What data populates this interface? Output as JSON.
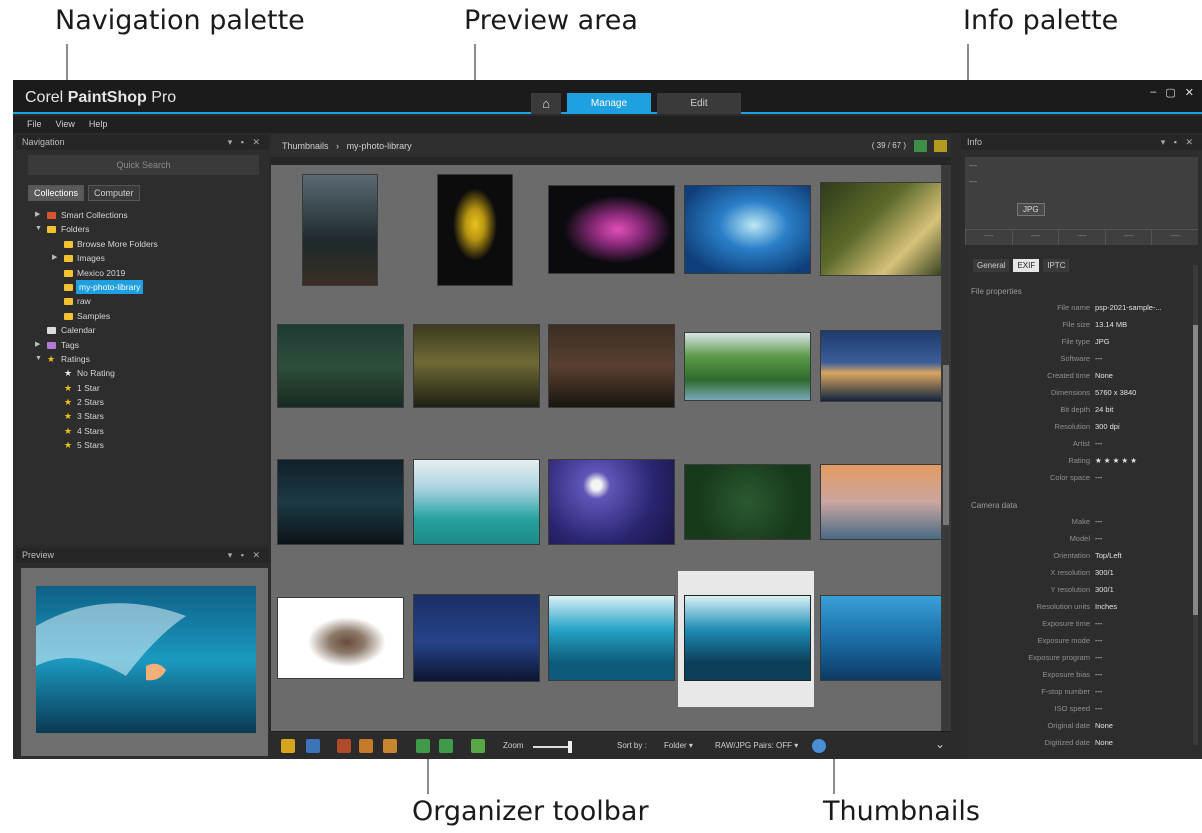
{
  "callouts": {
    "navigation": "Navigation palette",
    "preview_area": "Preview area",
    "info": "Info palette",
    "organizer": "Organizer toolbar",
    "thumbnails": "Thumbnails"
  },
  "app": {
    "logo_prefix": "Corel",
    "logo_main": "PaintShop",
    "logo_suffix": "Pro",
    "tabs": {
      "home": "⌂",
      "manage": "Manage",
      "edit": "Edit"
    },
    "window_controls": [
      "–",
      "▢",
      "✕"
    ],
    "menu": [
      "File",
      "View",
      "Help"
    ]
  },
  "navigation": {
    "title": "Navigation",
    "controls": "▾ ▪ ✕",
    "search_placeholder": "Quick Search",
    "seg": [
      "Collections",
      "Computer"
    ],
    "tree": [
      {
        "label": "Smart Collections",
        "icon": "smart-collections-icon"
      },
      {
        "label": "Folders",
        "icon": "folder-icon"
      },
      {
        "label": "Browse More Folders",
        "icon": "folder-plus-icon"
      },
      {
        "label": "Images",
        "icon": "folder-icon"
      },
      {
        "label": "Mexico 2019",
        "icon": "folder-icon"
      },
      {
        "label": "my-photo-library",
        "icon": "folder-icon"
      },
      {
        "label": "raw",
        "icon": "folder-icon"
      },
      {
        "label": "Samples",
        "icon": "folder-icon"
      },
      {
        "label": "Calendar",
        "icon": "calendar-icon"
      },
      {
        "label": "Tags",
        "icon": "tag-icon"
      },
      {
        "label": "Ratings",
        "icon": "star-icon"
      },
      {
        "label": "No Rating",
        "icon": "star-icon"
      },
      {
        "label": "1 Star",
        "icon": "star-icon"
      },
      {
        "label": "2 Stars",
        "icon": "star-icon"
      },
      {
        "label": "3 Stars",
        "icon": "star-icon"
      },
      {
        "label": "4 Stars",
        "icon": "star-icon"
      },
      {
        "label": "5 Stars",
        "icon": "star-icon"
      }
    ]
  },
  "preview": {
    "title": "Preview",
    "controls": "▾ ▪ ✕"
  },
  "browser": {
    "crumb_root": "Thumbnails",
    "crumb_sep": "›",
    "crumb_folder": "my-photo-library",
    "count": "( 39 / 67 )"
  },
  "toolbar": {
    "zoom_label": "Zoom",
    "sort_label": "Sort by :",
    "sort_value": "Folder ▾",
    "raw_label": "RAW/JPG Pairs: OFF ▾",
    "collapse": "⌄"
  },
  "info": {
    "title": "Info",
    "controls": "▾ ▪ ✕",
    "format": "JPG",
    "dashes": [
      "—",
      "—",
      "—"
    ],
    "cells": [
      "----",
      "----",
      "----",
      "----",
      "----"
    ],
    "tabs": [
      "General",
      "EXIF",
      "IPTC"
    ],
    "file_section": "File properties",
    "camera_section": "Camera data",
    "file_props": [
      {
        "k": "File name",
        "v": "psp-2021-sample-..."
      },
      {
        "k": "File size",
        "v": "13.14 MB"
      },
      {
        "k": "File type",
        "v": "JPG"
      },
      {
        "k": "Software",
        "v": "---"
      },
      {
        "k": "Created time",
        "v": "None"
      },
      {
        "k": "Dimensions",
        "v": "5760 x 3840"
      },
      {
        "k": "Bit depth",
        "v": "24 bit"
      },
      {
        "k": "Resolution",
        "v": "300 dpi"
      },
      {
        "k": "Artist",
        "v": "---"
      },
      {
        "k": "Rating",
        "v": "★ ★ ★ ★ ★"
      },
      {
        "k": "Color space",
        "v": "---"
      }
    ],
    "camera_props": [
      {
        "k": "Make",
        "v": "---"
      },
      {
        "k": "Model",
        "v": "---"
      },
      {
        "k": "Orientation",
        "v": "Top/Left"
      },
      {
        "k": "X resolution",
        "v": "300/1"
      },
      {
        "k": "Y resolution",
        "v": "300/1"
      },
      {
        "k": "Resolution units",
        "v": "Inches"
      },
      {
        "k": "Exposure time",
        "v": "---"
      },
      {
        "k": "Exposure mode",
        "v": "---"
      },
      {
        "k": "Exposure program",
        "v": "---"
      },
      {
        "k": "Exposure bias",
        "v": "---"
      },
      {
        "k": "F-stop number",
        "v": "---"
      },
      {
        "k": "ISO speed",
        "v": "---"
      },
      {
        "k": "Original date",
        "v": "None"
      },
      {
        "k": "Digitized date",
        "v": "None"
      }
    ]
  },
  "colors": {
    "accent": "#1fa0e0",
    "star": "#f0c020",
    "folder": "#f2c230"
  }
}
